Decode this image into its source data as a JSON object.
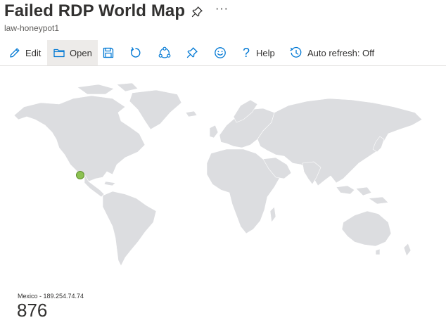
{
  "page": {
    "title": "Failed RDP World Map",
    "subtitle": "law-honeypot1"
  },
  "toolbar": {
    "edit_label": "Edit",
    "open_label": "Open",
    "help_label": "Help",
    "auto_refresh_label": "Auto refresh: Off"
  },
  "icons": {
    "pin": "pin-icon",
    "more": "more-icon",
    "edit": "pencil-icon",
    "open": "folder-icon",
    "save": "save-icon",
    "refresh": "refresh-icon",
    "share": "share-icon",
    "pin_toolbar": "pin-icon",
    "feedback": "smiley-icon",
    "help": "question-icon",
    "auto_refresh": "clock-icon"
  },
  "colors": {
    "accent": "#0078d4",
    "land": "#dcdde0",
    "marker_fill": "#8cc152",
    "marker_stroke": "#5e8f2a"
  },
  "map": {
    "markers": [
      {
        "country": "Mexico",
        "ip": "189.254.74.74",
        "count": 876
      }
    ]
  },
  "legend": {
    "label": "Mexico - 189.254.74.74",
    "value": "876"
  }
}
